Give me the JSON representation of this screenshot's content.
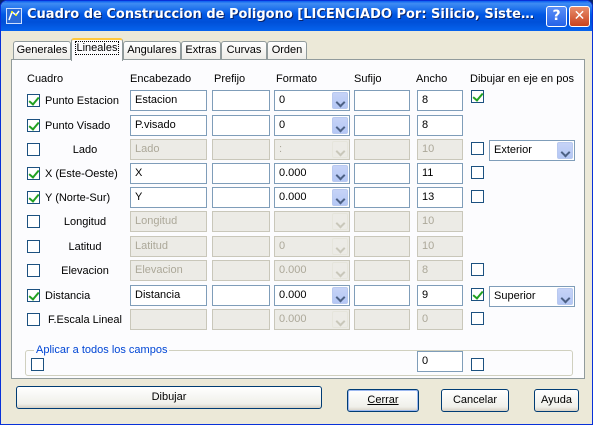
{
  "window": {
    "title": "Cuadro de Construccion de Poligono  [LICENCIADO Por: Silicio, Sistemas e Ingeniería",
    "help_label": "?",
    "close_label": "✕"
  },
  "tabs": [
    {
      "label": "Generales",
      "active": false
    },
    {
      "label": "Lineales",
      "active": true
    },
    {
      "label": "Angulares",
      "active": false
    },
    {
      "label": "Extras",
      "active": false
    },
    {
      "label": "Curvas",
      "active": false
    },
    {
      "label": "Orden",
      "active": false
    }
  ],
  "headers": {
    "cuadro": "Cuadro",
    "encabezado": "Encabezado",
    "prefijo": "Prefijo",
    "formato": "Formato",
    "sufijo": "Sufijo",
    "ancho": "Ancho",
    "dibujar": "Dibujar en eje en pos"
  },
  "rows": [
    {
      "label": "Punto Estacion",
      "checked": true,
      "enabled": true,
      "encabezado": "Estacion",
      "prefijo": "",
      "formato": "0",
      "sufijo": "",
      "ancho": "8",
      "eje_checked": true,
      "pos": null
    },
    {
      "label": "Punto Visado",
      "checked": true,
      "enabled": true,
      "encabezado": "P.visado",
      "prefijo": "",
      "formato": "0",
      "sufijo": "",
      "ancho": "8",
      "eje_checked": null,
      "pos": null
    },
    {
      "label": "Lado",
      "checked": false,
      "enabled": false,
      "encabezado": "Lado",
      "prefijo": "",
      "formato": ":",
      "sufijo": "",
      "ancho": "10",
      "eje_checked": false,
      "pos": "Exterior"
    },
    {
      "label": "X (Este-Oeste)",
      "checked": true,
      "enabled": true,
      "encabezado": "X",
      "prefijo": "",
      "formato": "0.000",
      "sufijo": "",
      "ancho": "11",
      "eje_checked": false,
      "pos": null
    },
    {
      "label": "Y (Norte-Sur)",
      "checked": true,
      "enabled": true,
      "encabezado": "Y",
      "prefijo": "",
      "formato": "0.000",
      "sufijo": "",
      "ancho": "13",
      "eje_checked": false,
      "pos": null
    },
    {
      "label": "Longitud",
      "checked": false,
      "enabled": false,
      "encabezado": "Longitud",
      "prefijo": "",
      "formato": "",
      "sufijo": "",
      "ancho": "10",
      "eje_checked": null,
      "pos": null
    },
    {
      "label": "Latitud",
      "checked": false,
      "enabled": false,
      "encabezado": "Latitud",
      "prefijo": "",
      "formato": "0",
      "sufijo": "",
      "ancho": "10",
      "eje_checked": null,
      "pos": null
    },
    {
      "label": "Elevacion",
      "checked": false,
      "enabled": false,
      "encabezado": "Elevacion",
      "prefijo": "",
      "formato": "0.000",
      "sufijo": "",
      "ancho": "8",
      "eje_checked": false,
      "pos": null
    },
    {
      "label": "Distancia",
      "checked": true,
      "enabled": true,
      "encabezado": "Distancia",
      "prefijo": "",
      "formato": "0.000",
      "sufijo": "",
      "ancho": "9",
      "eje_checked": true,
      "pos": "Superior"
    },
    {
      "label": "F.Escala Lineal",
      "checked": false,
      "enabled": false,
      "encabezado": "",
      "prefijo": "",
      "formato": "0.000",
      "sufijo": "",
      "ancho": "0",
      "eje_checked": false,
      "pos": null
    }
  ],
  "apply_all": {
    "label": "Aplicar a todos los campos",
    "checked": false,
    "ancho": "0",
    "eje_checked": false
  },
  "buttons": {
    "dibujar": "Dibujar",
    "cerrar": "Cerrar",
    "cancelar": "Cancelar",
    "ayuda": "Ayuda"
  },
  "colors": {
    "accent": "#0046d5",
    "check": "#21a121"
  }
}
